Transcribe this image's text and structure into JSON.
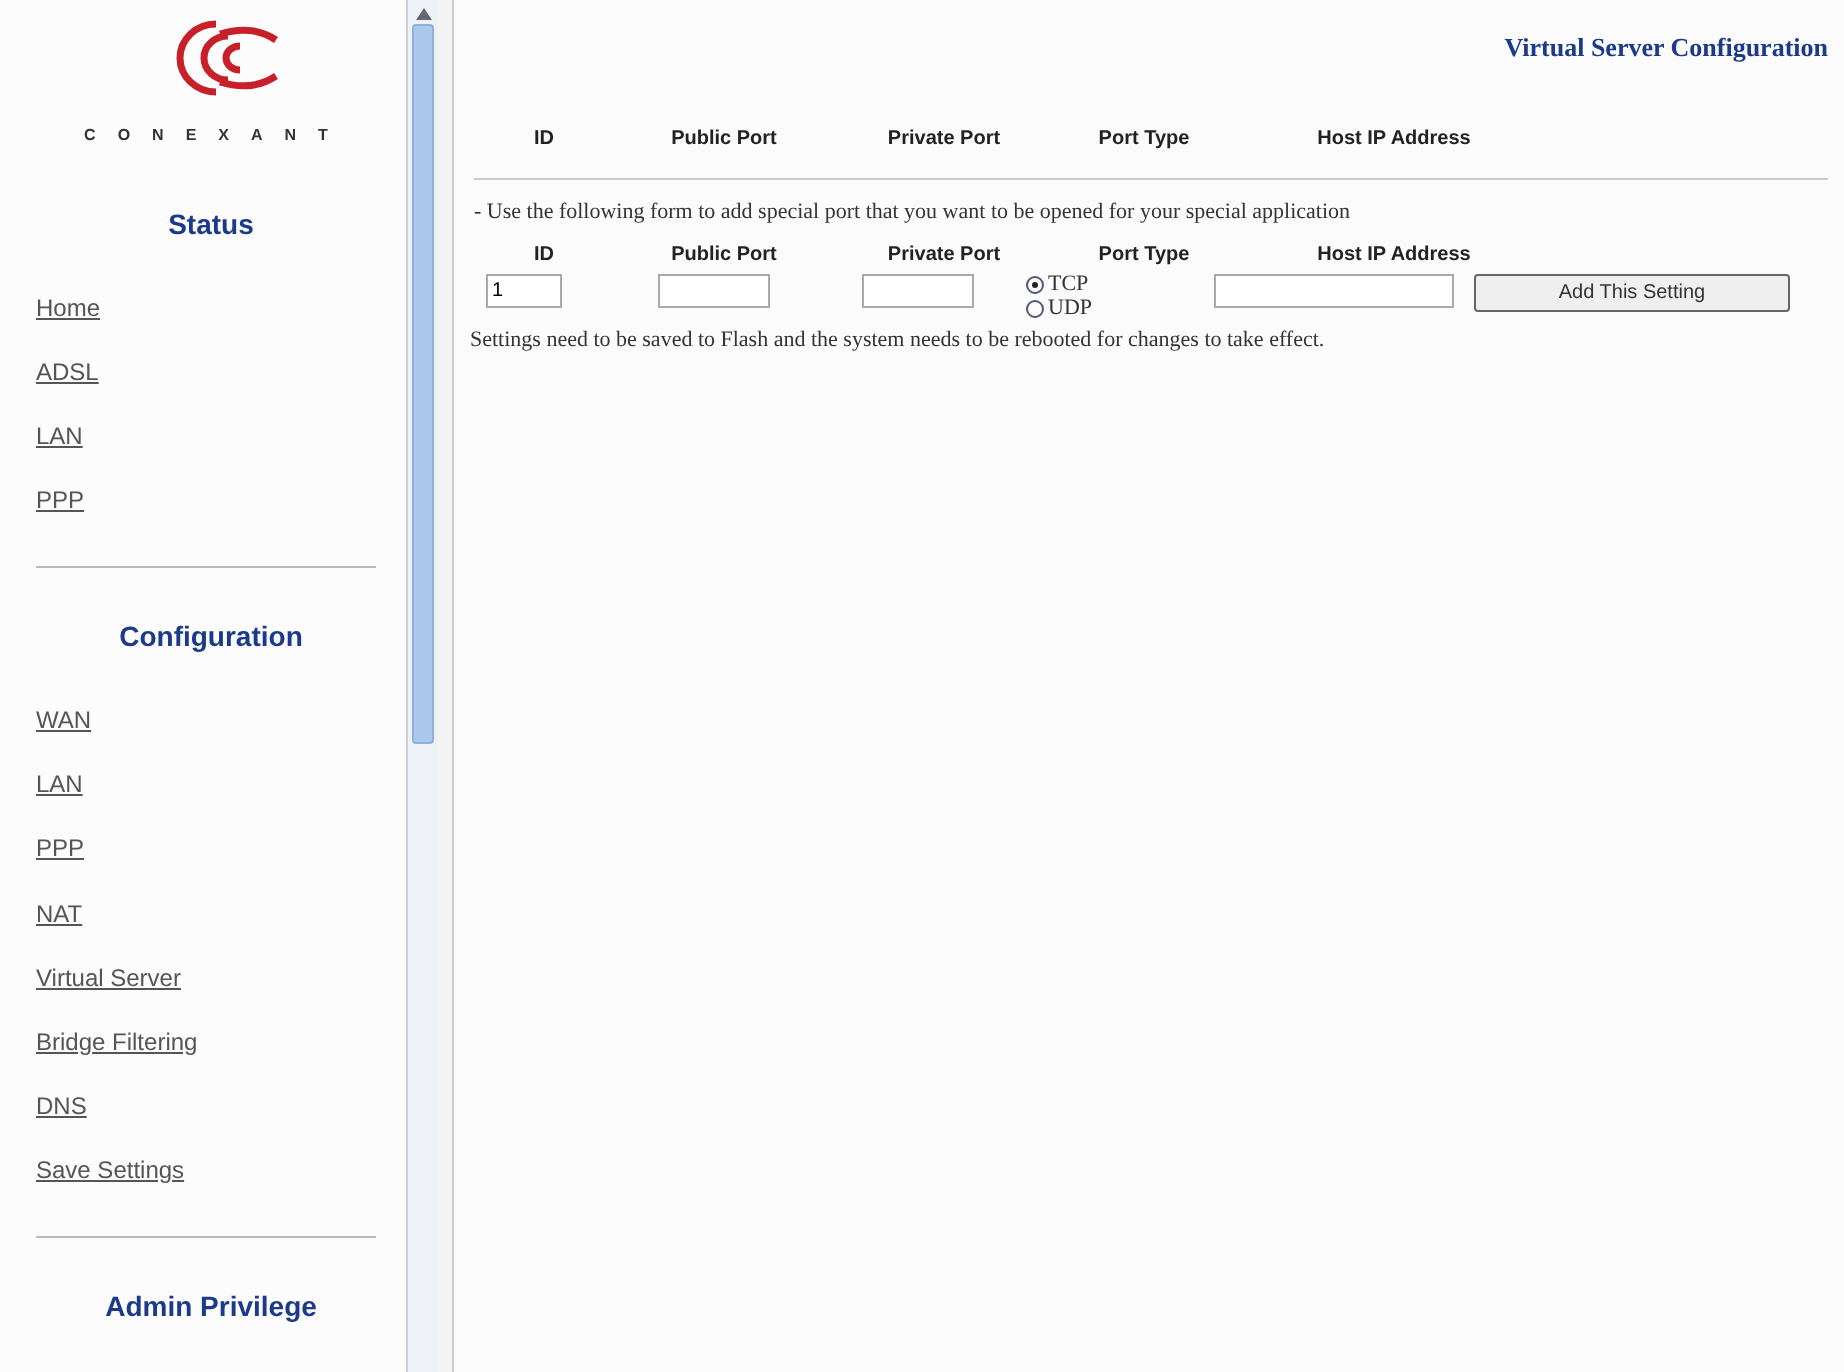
{
  "logo": {
    "wordmark": "CONEXANT"
  },
  "sidebar": {
    "sections": [
      {
        "heading": "Status",
        "items": [
          {
            "label": "Home"
          },
          {
            "label": "ADSL"
          },
          {
            "label": "LAN"
          },
          {
            "label": "PPP"
          }
        ]
      },
      {
        "heading": "Configuration",
        "items": [
          {
            "label": "WAN"
          },
          {
            "label": "LAN"
          },
          {
            "label": "PPP"
          },
          {
            "label": "NAT"
          },
          {
            "label": "Virtual Server"
          },
          {
            "label": "Bridge Filtering"
          },
          {
            "label": "DNS"
          },
          {
            "label": "Save Settings"
          }
        ]
      },
      {
        "heading": "Admin Privilege"
      }
    ]
  },
  "page_title": "Virtual Server Configuration",
  "table": {
    "columns": [
      "ID",
      "Public Port",
      "Private Port",
      "Port Type",
      "Host IP Address"
    ]
  },
  "form": {
    "intro": "- Use the following form to add special port that you want to be opened for your special application",
    "columns": [
      "ID",
      "Public Port",
      "Private Port",
      "Port Type",
      "Host IP Address"
    ],
    "id_value": "1",
    "port_types": [
      {
        "label": "TCP",
        "selected": true
      },
      {
        "label": "UDP",
        "selected": false
      }
    ],
    "submit": "Add This Setting"
  },
  "note": "Settings need to be saved to Flash and the system needs to be rebooted for changes to take effect."
}
